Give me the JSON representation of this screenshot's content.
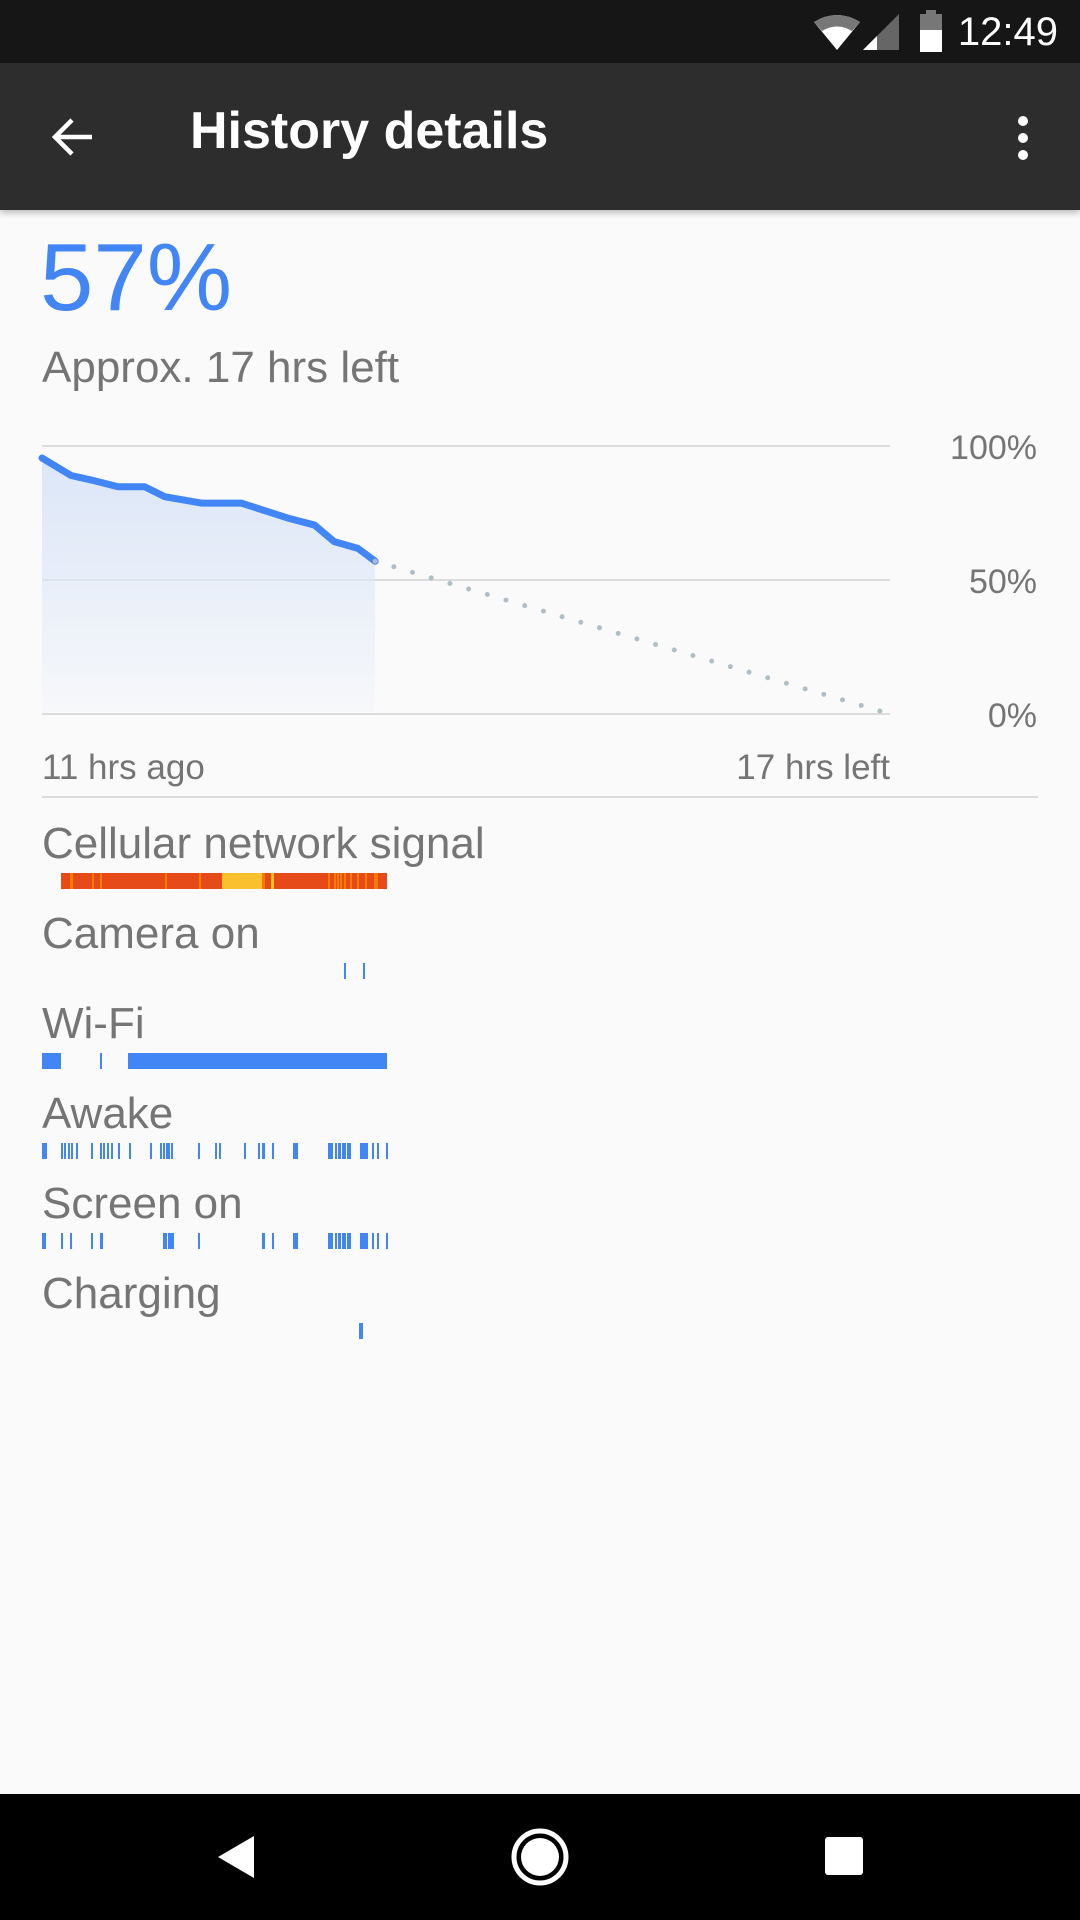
{
  "status_bar": {
    "time": "12:49",
    "icons": [
      "wifi-icon",
      "cell-signal-icon",
      "battery-icon"
    ]
  },
  "app_bar": {
    "title": "History details",
    "back_icon": "arrow-back-icon",
    "menu_icon": "more-vert-icon"
  },
  "summary": {
    "percent": "57%",
    "remaining": "Approx. 17 hrs left"
  },
  "chart_data": {
    "type": "line",
    "x_unit": "hours from start of history",
    "history_hours": 11,
    "projection_hours": 17,
    "xtick_labels": [
      "11 hrs ago",
      "17 hrs left"
    ],
    "ytick_labels": [
      "100%",
      "50%",
      "0%"
    ],
    "ylim": [
      0,
      100
    ],
    "grid": true,
    "series": [
      {
        "x": [
          0,
          0.96,
          1.63,
          2.51,
          3.39,
          4.05,
          5.26,
          6.58,
          8.12,
          9.0,
          9.65,
          10.43,
          11
        ],
        "y": [
          95.5,
          89,
          87.3,
          84.8,
          84.8,
          81.1,
          78.7,
          78.7,
          73.1,
          70.5,
          64.3,
          61.8,
          57
        ]
      }
    ],
    "projection": {
      "x": [
        11,
        28
      ],
      "y": [
        57,
        0
      ]
    },
    "colors": {
      "line": "#4285f4",
      "fill": "#dbe6f8",
      "projection": "#b0bec5",
      "grid": "#dcdcdc"
    }
  },
  "timelines": [
    {
      "label": "Cellular network signal",
      "type": "signal",
      "colors": {
        "poor": "#e64a19",
        "moderate": "#f57c00",
        "good": "#fbc02d"
      },
      "segments": [
        {
          "start": 0.6,
          "end": 11,
          "level": "poor"
        },
        {
          "start": 0.9,
          "end": 1.0,
          "level": "moderate"
        },
        {
          "start": 1.6,
          "end": 1.66,
          "level": "moderate"
        },
        {
          "start": 1.86,
          "end": 1.92,
          "level": "moderate"
        },
        {
          "start": 3.92,
          "end": 4.0,
          "level": "moderate"
        },
        {
          "start": 5.02,
          "end": 5.08,
          "level": "moderate"
        },
        {
          "start": 5.75,
          "end": 7.0,
          "level": "good"
        },
        {
          "start": 7.0,
          "end": 7.12,
          "level": "moderate"
        },
        {
          "start": 7.3,
          "end": 7.4,
          "level": "good"
        },
        {
          "start": 9.12,
          "end": 9.15,
          "level": "moderate"
        },
        {
          "start": 9.3,
          "end": 9.33,
          "level": "moderate"
        },
        {
          "start": 9.4,
          "end": 9.43,
          "level": "moderate"
        },
        {
          "start": 9.5,
          "end": 9.53,
          "level": "moderate"
        },
        {
          "start": 9.62,
          "end": 9.65,
          "level": "moderate"
        },
        {
          "start": 9.82,
          "end": 9.85,
          "level": "moderate"
        },
        {
          "start": 10.05,
          "end": 10.08,
          "level": "moderate"
        },
        {
          "start": 10.3,
          "end": 10.33,
          "level": "moderate"
        },
        {
          "start": 10.6,
          "end": 10.7,
          "level": "moderate"
        }
      ]
    },
    {
      "label": "Camera on",
      "color": "#4285f4",
      "segments": [
        {
          "start": 9.62,
          "end": 9.65
        },
        {
          "start": 10.24,
          "end": 10.3
        }
      ]
    },
    {
      "label": "Wi-Fi",
      "color": "#4285f4",
      "segments": [
        {
          "start": 0,
          "end": 0.6
        },
        {
          "start": 1.85,
          "end": 1.88
        },
        {
          "start": 2.75,
          "end": 11
        }
      ]
    },
    {
      "label": "Awake",
      "color": "#4285f4",
      "segments": [
        {
          "start": 0,
          "end": 0.15
        },
        {
          "start": 0.61,
          "end": 0.66
        },
        {
          "start": 0.71,
          "end": 0.77
        },
        {
          "start": 0.82,
          "end": 0.87
        },
        {
          "start": 0.94,
          "end": 0.98
        },
        {
          "start": 1.09,
          "end": 1.13
        },
        {
          "start": 1.57,
          "end": 1.62
        },
        {
          "start": 1.85,
          "end": 1.91
        },
        {
          "start": 1.96,
          "end": 2.01
        },
        {
          "start": 2.07,
          "end": 2.12
        },
        {
          "start": 2.2,
          "end": 2.25
        },
        {
          "start": 2.42,
          "end": 2.45
        },
        {
          "start": 2.76,
          "end": 2.78
        },
        {
          "start": 3.45,
          "end": 3.47
        },
        {
          "start": 3.75,
          "end": 3.78
        },
        {
          "start": 3.86,
          "end": 3.89
        },
        {
          "start": 3.94,
          "end": 3.97
        },
        {
          "start": 4.03,
          "end": 4.06
        },
        {
          "start": 4.11,
          "end": 4.18
        },
        {
          "start": 4.96,
          "end": 5.05
        },
        {
          "start": 5.53,
          "end": 5.56
        },
        {
          "start": 5.63,
          "end": 5.65
        },
        {
          "start": 6.43,
          "end": 6.45
        },
        {
          "start": 6.88,
          "end": 6.9
        },
        {
          "start": 7.0,
          "end": 7.12
        },
        {
          "start": 7.34,
          "end": 7.36
        },
        {
          "start": 7.99,
          "end": 8.17
        },
        {
          "start": 9.11,
          "end": 9.29
        },
        {
          "start": 9.33,
          "end": 9.39
        },
        {
          "start": 9.45,
          "end": 9.52
        },
        {
          "start": 9.58,
          "end": 9.69
        },
        {
          "start": 9.73,
          "end": 9.84
        },
        {
          "start": 10.14,
          "end": 10.41
        },
        {
          "start": 10.51,
          "end": 10.6
        },
        {
          "start": 10.67,
          "end": 10.76
        },
        {
          "start": 10.96,
          "end": 11
        }
      ]
    },
    {
      "label": "Screen on",
      "color": "#4285f4",
      "segments": [
        {
          "start": 0,
          "end": 0.12
        },
        {
          "start": 0.61,
          "end": 0.66
        },
        {
          "start": 0.89,
          "end": 0.95
        },
        {
          "start": 1.57,
          "end": 1.6
        },
        {
          "start": 1.85,
          "end": 1.94
        },
        {
          "start": 3.87,
          "end": 3.97
        },
        {
          "start": 4.02,
          "end": 4.06
        },
        {
          "start": 4.09,
          "end": 4.12
        },
        {
          "start": 4.15,
          "end": 4.19
        },
        {
          "start": 4.96,
          "end": 5.05
        },
        {
          "start": 7.0,
          "end": 7.12
        },
        {
          "start": 7.34,
          "end": 7.36
        },
        {
          "start": 7.99,
          "end": 8.17
        },
        {
          "start": 9.11,
          "end": 9.29
        },
        {
          "start": 9.33,
          "end": 9.39
        },
        {
          "start": 9.45,
          "end": 9.52
        },
        {
          "start": 9.58,
          "end": 9.69
        },
        {
          "start": 9.73,
          "end": 9.84
        },
        {
          "start": 10.14,
          "end": 10.41
        },
        {
          "start": 10.51,
          "end": 10.6
        },
        {
          "start": 10.67,
          "end": 10.76
        },
        {
          "start": 10.96,
          "end": 11
        }
      ]
    },
    {
      "label": "Charging",
      "color": "#4285f4",
      "segments": [
        {
          "start": 10.12,
          "end": 10.22
        }
      ]
    }
  ],
  "nav_bar": {
    "icons": [
      "back-triangle-icon",
      "home-circle-icon",
      "recents-square-icon"
    ]
  }
}
